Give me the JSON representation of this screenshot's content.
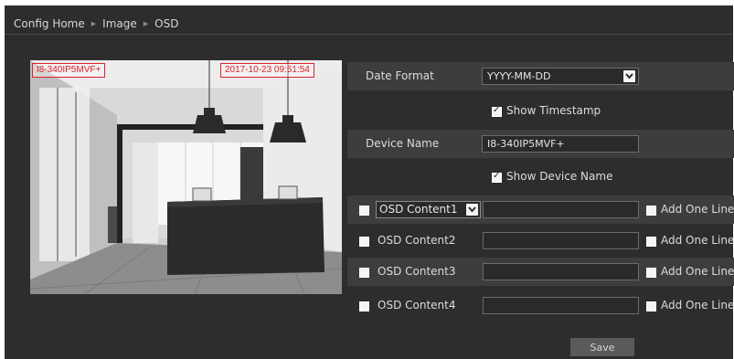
{
  "breadcrumb": [
    "Config Home",
    "Image",
    "OSD"
  ],
  "preview": {
    "device_overlay": "I8-340IP5MVF+",
    "timestamp_overlay": "2017-10-23  09:51:54"
  },
  "date_format": {
    "label": "Date Format",
    "value": "YYYY-MM-DD"
  },
  "show_timestamp": {
    "label": "Show Timestamp",
    "checked": true
  },
  "device_name": {
    "label": "Device Name",
    "value": "I8-340IP5MVF+"
  },
  "show_device_name": {
    "label": "Show Device Name",
    "checked": true
  },
  "osd_rows": [
    {
      "label": "OSD Content1",
      "checked": false,
      "value": "",
      "add_line": "Add One Line",
      "add_checked": false
    },
    {
      "label": "OSD Content2",
      "checked": false,
      "value": "",
      "add_line": "Add One Line",
      "add_checked": false
    },
    {
      "label": "OSD Content3",
      "checked": false,
      "value": "",
      "add_line": "Add One Line",
      "add_checked": false
    },
    {
      "label": "OSD Content4",
      "checked": false,
      "value": "",
      "add_line": "Add One Line",
      "add_checked": false
    }
  ],
  "save_label": "Save",
  "icons": {
    "breadcrumb_separator": "triangle-right-icon",
    "dropdown": "chevron-down-icon",
    "checkbox": "checkbox-icon"
  }
}
